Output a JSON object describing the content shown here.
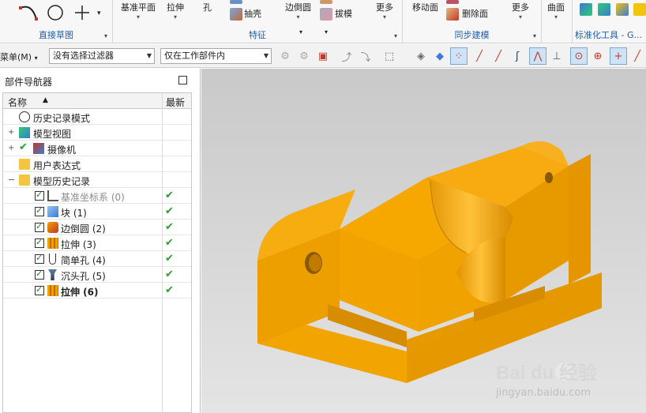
{
  "ribbon": {
    "sketch_group_label": "直接草图",
    "feature_group_label": "特征",
    "sync_group_label": "同步建模",
    "std_group_label": "标准化工具 - G...",
    "buttons": {
      "datum_plane": "基准平面",
      "extrude": "拉伸",
      "hole": "孔",
      "shell": "抽壳",
      "edge_blend": "边倒圆",
      "draft": "拔模",
      "more1": "更多",
      "move_face": "移动面",
      "delete_face": "删除面",
      "more2": "更多",
      "surface": "曲面"
    }
  },
  "toolbar": {
    "menu_label": "菜单(M)",
    "filter_select": "没有选择过滤器",
    "scope_select": "仅在工作部件内"
  },
  "navigator": {
    "title": "部件导航器",
    "col_name": "名称",
    "col_newest": "最新",
    "rows": [
      {
        "label": "历史记录模式"
      },
      {
        "label": "模型视图"
      },
      {
        "label": "摄像机"
      },
      {
        "label": "用户表达式"
      },
      {
        "label": "模型历史记录"
      },
      {
        "label": "基准坐标系 (0)"
      },
      {
        "label": "块 (1)"
      },
      {
        "label": "边倒圆 (2)"
      },
      {
        "label": "拉伸 (3)"
      },
      {
        "label": "简单孔 (4)"
      },
      {
        "label": "沉头孔 (5)"
      },
      {
        "label": "拉伸 (6)"
      }
    ]
  },
  "watermark": {
    "brand": "Bai du 经验",
    "url": "jingyan.baidu.com"
  },
  "colors": {
    "model_orange": "#f0a000",
    "check_green": "#27a127",
    "group_label_blue": "#1f5fa8"
  }
}
